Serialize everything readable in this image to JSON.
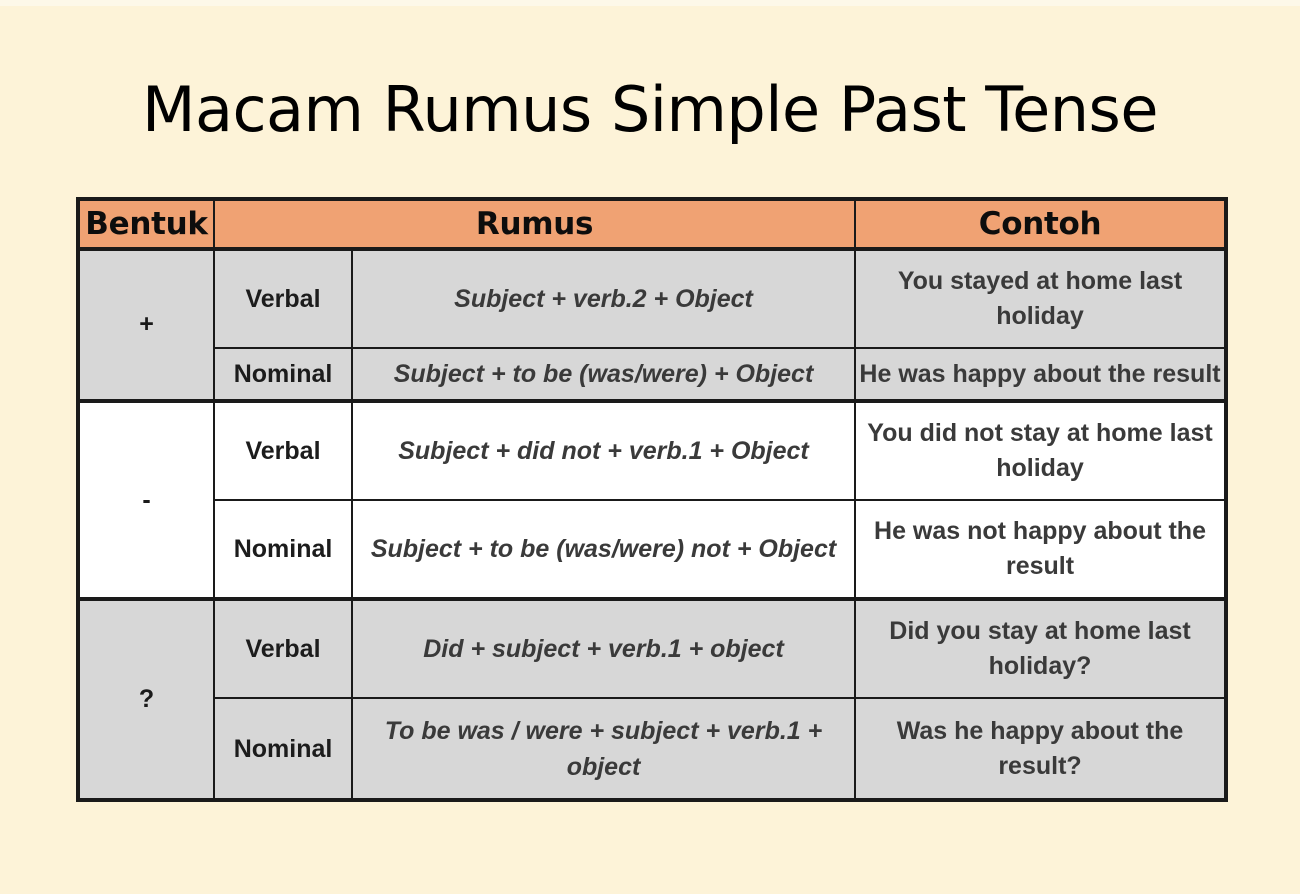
{
  "page": {
    "title": "Macam Rumus Simple Past Tense",
    "background_color": "#fdf3d8"
  },
  "colors": {
    "header_background": "#f0a273",
    "row_gray": "#d7d7d7",
    "row_white": "#ffffff",
    "border": "#1a1a1a",
    "body_text": "#3a3a3a",
    "title_text": "#000000"
  },
  "table": {
    "headers": {
      "bentuk": "Bentuk",
      "rumus": "Rumus",
      "contoh": "Contoh"
    },
    "groups": [
      {
        "bentuk": "+",
        "shade": "gray",
        "rows": [
          {
            "kind": "Verbal",
            "rumus": "Subject + verb.2 + Object",
            "contoh": "You stayed at home last holiday"
          },
          {
            "kind": "Nominal",
            "rumus": "Subject + to be (was/were) + Object",
            "contoh": "He was happy about the result"
          }
        ]
      },
      {
        "bentuk": "-",
        "shade": "white",
        "rows": [
          {
            "kind": "Verbal",
            "rumus": "Subject + did not + verb.1 + Object",
            "contoh": "You did not stay at home last holiday"
          },
          {
            "kind": "Nominal",
            "rumus": "Subject + to be (was/were) not + Object",
            "contoh": "He was not happy about the result"
          }
        ]
      },
      {
        "bentuk": "?",
        "shade": "gray",
        "rows": [
          {
            "kind": "Verbal",
            "rumus": "Did + subject + verb.1 + object",
            "contoh": "Did you stay at home last holiday?"
          },
          {
            "kind": "Nominal",
            "rumus": "To be was / were + subject + verb.1 + object",
            "contoh": "Was he happy about the result?"
          }
        ]
      }
    ]
  }
}
